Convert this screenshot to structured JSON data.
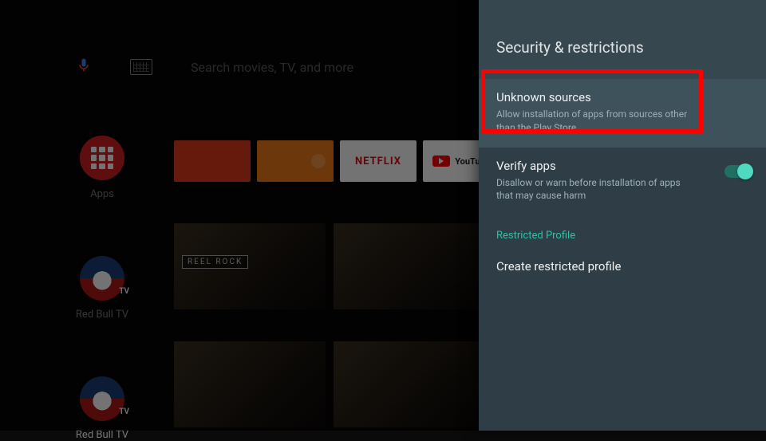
{
  "search": {
    "placeholder": "Search movies, TV, and more"
  },
  "leftApps": {
    "apps_label": "Apps",
    "redbull_label": "Red Bull TV",
    "redbull_label2": "Red Bull TV"
  },
  "tiles": {
    "netflix": "NETFLIX",
    "youtube": "YouTube"
  },
  "thumb_tag": "REEL ROCK",
  "panel": {
    "title": "Security & restrictions",
    "unknown": {
      "title": "Unknown sources",
      "desc": "Allow installation of apps from sources other than the Play Store"
    },
    "verify": {
      "title": "Verify apps",
      "desc": "Disallow or warn before installation of apps that may cause harm"
    },
    "section": "Restricted Profile",
    "create": "Create restricted profile"
  }
}
